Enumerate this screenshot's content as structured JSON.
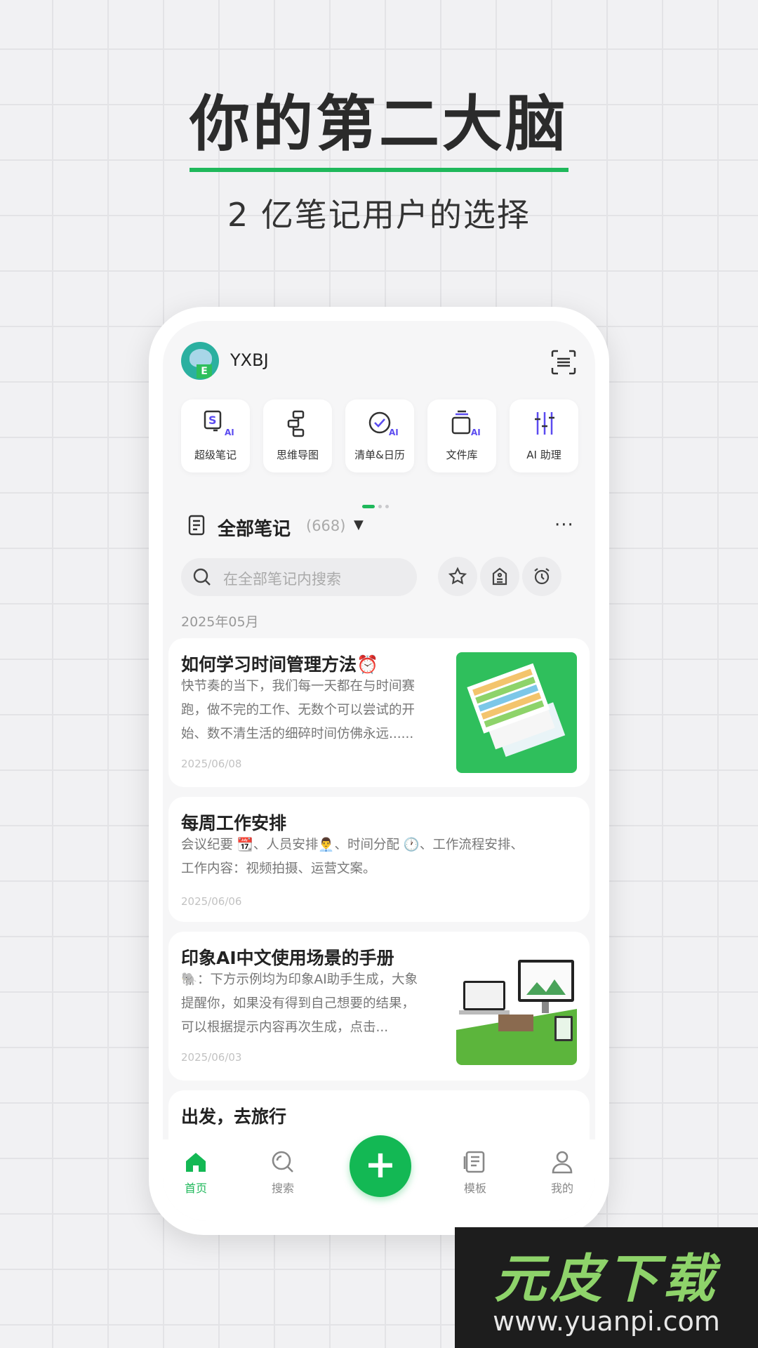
{
  "headline": {
    "title": "你的第二大脑",
    "subtitle": "2 亿笔记用户的选择"
  },
  "header": {
    "username": "YXBJ",
    "avatar_letter": "E",
    "scan_icon": "scan-icon"
  },
  "tools": [
    {
      "label": "超级笔记",
      "icon": "super-note-icon",
      "badge": "AI"
    },
    {
      "label": "思维导图",
      "icon": "mindmap-icon"
    },
    {
      "label": "清单&日历",
      "icon": "checklist-icon",
      "badge": "AI"
    },
    {
      "label": "文件库",
      "icon": "file-library-icon",
      "badge": "AI"
    },
    {
      "label": "AI 助理",
      "icon": "ai-assistant-icon"
    }
  ],
  "notes_section": {
    "title": "全部笔记",
    "count": "(668)",
    "caret": "▼",
    "more": "···",
    "search_placeholder": "在全部笔记内搜索",
    "month": "2025年05月"
  },
  "notes": [
    {
      "title": "如何学习时间管理方法⏰",
      "lines": [
        "快节奏的当下，我们每一天都在与时间赛",
        "跑，做不完的工作、无数个可以尝试的开",
        "始、数不清生活的细碎时间仿佛永远......"
      ],
      "date": "2025/06/08"
    },
    {
      "title": "每周工作安排",
      "lines": [
        "会议纪要 📆、人员安排👨‍💼、时间分配 🕐、工作流程安排、",
        "工作内容：视频拍摄、运营文案。"
      ],
      "date": "2025/06/06"
    },
    {
      "title": "印象AI中文使用场景的手册",
      "lines": [
        "🐘：下方示例均为印象AI助手生成，大象",
        "提醒你，如果没有得到自己想要的结果，",
        "可以根据提示内容再次生成，点击..."
      ],
      "date": "2025/06/03"
    },
    {
      "title": "出发，去旅行"
    }
  ],
  "bottom_nav": {
    "home": "首页",
    "search": "搜索",
    "add": "+",
    "templates": "模板",
    "mine": "我的"
  },
  "watermark": {
    "brand": "元皮下载",
    "url": "www.yuanpi.com"
  },
  "colors": {
    "accent": "#13b854",
    "ai_badge": "#5b4bf0",
    "background": "#f1f1f3"
  }
}
